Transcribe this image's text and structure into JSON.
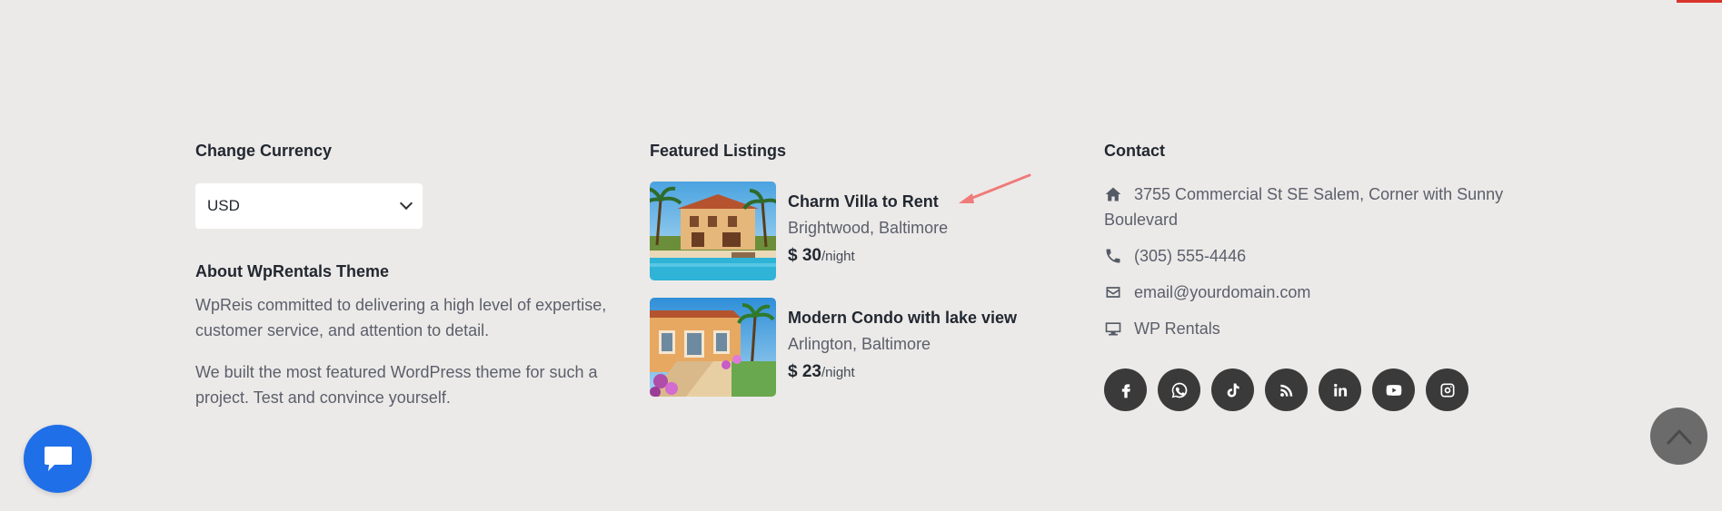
{
  "currency": {
    "heading": "Change Currency",
    "selected": "USD"
  },
  "about": {
    "heading": "About WpRentals Theme",
    "paragraphs": [
      "WpReis committed to delivering a high level of expertise, customer service, and attention to detail.",
      "We built the most featured WordPress theme for such a project. Test and convince yourself."
    ]
  },
  "featured": {
    "heading": "Featured Listings",
    "listings": [
      {
        "title": "Charm Villa to Rent",
        "location": "Brightwood, Baltimore",
        "price": "$ 30",
        "unit": "/night"
      },
      {
        "title": "Modern Condo with lake view",
        "location": "Arlington, Baltimore",
        "price": "$ 23",
        "unit": "/night"
      }
    ]
  },
  "contact": {
    "heading": "Contact",
    "address": "3755 Commercial St SE Salem, Corner with Sunny Boulevard",
    "phone": "(305) 555-4446",
    "email": "email@yourdomain.com",
    "website": "WP Rentals",
    "social_icons": [
      "facebook-icon",
      "whatsapp-icon",
      "tiktok-icon",
      "rss-icon",
      "linkedin-icon",
      "youtube-icon",
      "instagram-icon"
    ]
  },
  "colors": {
    "background": "#eceae8",
    "chat_button": "#1e6fe8",
    "social_bg": "#3a3a3a",
    "scroll_top_bg": "#6b6b6b",
    "annotation_arrow": "#ef7b7b",
    "top_accent": "#d9342b"
  },
  "floating": {
    "chat_icon": "chat-bubble-icon",
    "scroll_top_icon": "chevron-up-icon"
  }
}
